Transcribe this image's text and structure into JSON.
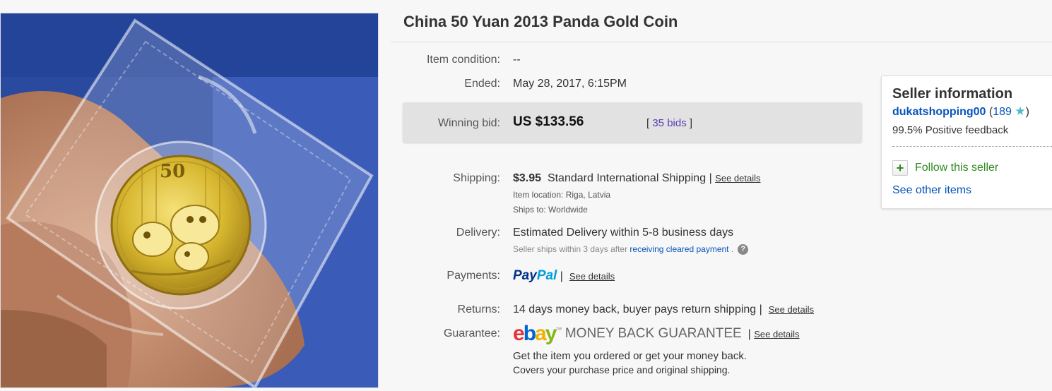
{
  "product": {
    "title": "China 50 Yuan 2013 Panda Gold Coin"
  },
  "coin": {
    "denomination": "50"
  },
  "details": {
    "condition_label": "Item condition:",
    "condition_value": "--",
    "ended_label": "Ended:",
    "ended_date": "May 28, 2017",
    "ended_time": ", 6:15PM"
  },
  "bid": {
    "label": "Winning bid:",
    "price": "US $133.56",
    "open_bracket": "[",
    "count_link": "35 bids",
    "close_bracket": "]"
  },
  "shipping": {
    "label": "Shipping:",
    "cost": "$3.95",
    "method": "Standard International Shipping",
    "separator": "|",
    "details_link": "See details",
    "location_label": "Item location:",
    "location_value": "Riga, Latvia",
    "ships_to_label": "Ships to:",
    "ships_to_value": "Worldwide"
  },
  "delivery": {
    "label": "Delivery:",
    "estimate": "Estimated Delivery within 5-8 business days",
    "note_prefix": "Seller ships within 3 days after",
    "note_link": "receiving cleared payment",
    "note_suffix": ".",
    "help_icon": "question-mark-icon",
    "help_glyph": "?"
  },
  "payments": {
    "label": "Payments:",
    "paypal_pay": "Pay",
    "paypal_pal": "Pal",
    "separator": "|",
    "details_link": "See details"
  },
  "returns": {
    "label": "Returns:",
    "text": "14 days money back, buyer pays return shipping",
    "separator": "|",
    "details_link": "See details"
  },
  "guarantee": {
    "label": "Guarantee:",
    "ebay_e": "e",
    "ebay_b": "b",
    "ebay_a": "a",
    "ebay_y": "y",
    "trademark": "™",
    "mbg_text": "MONEY BACK GUARANTEE",
    "separator": "|",
    "details_link": "See details",
    "line1": "Get the item you ordered or get your money back.",
    "line2": "Covers your purchase price and original shipping."
  },
  "seller": {
    "title": "Seller information",
    "username": "dukatshopping00",
    "open_paren": "(",
    "score": "189",
    "star_icon": "turquoise-star-icon",
    "star_glyph": "★",
    "close_paren": ")",
    "feedback": "99.5% Positive feedback",
    "follow_glyph": "+",
    "follow": "Follow this seller",
    "other_items": "See other items"
  },
  "colors": {
    "link_blue": "#0654ba",
    "bid_purple": "#5a3fb3",
    "follow_green": "#2d8a1e",
    "star_teal": "#4bbcc8",
    "paypal_dark": "#003087",
    "paypal_light": "#009cde"
  }
}
